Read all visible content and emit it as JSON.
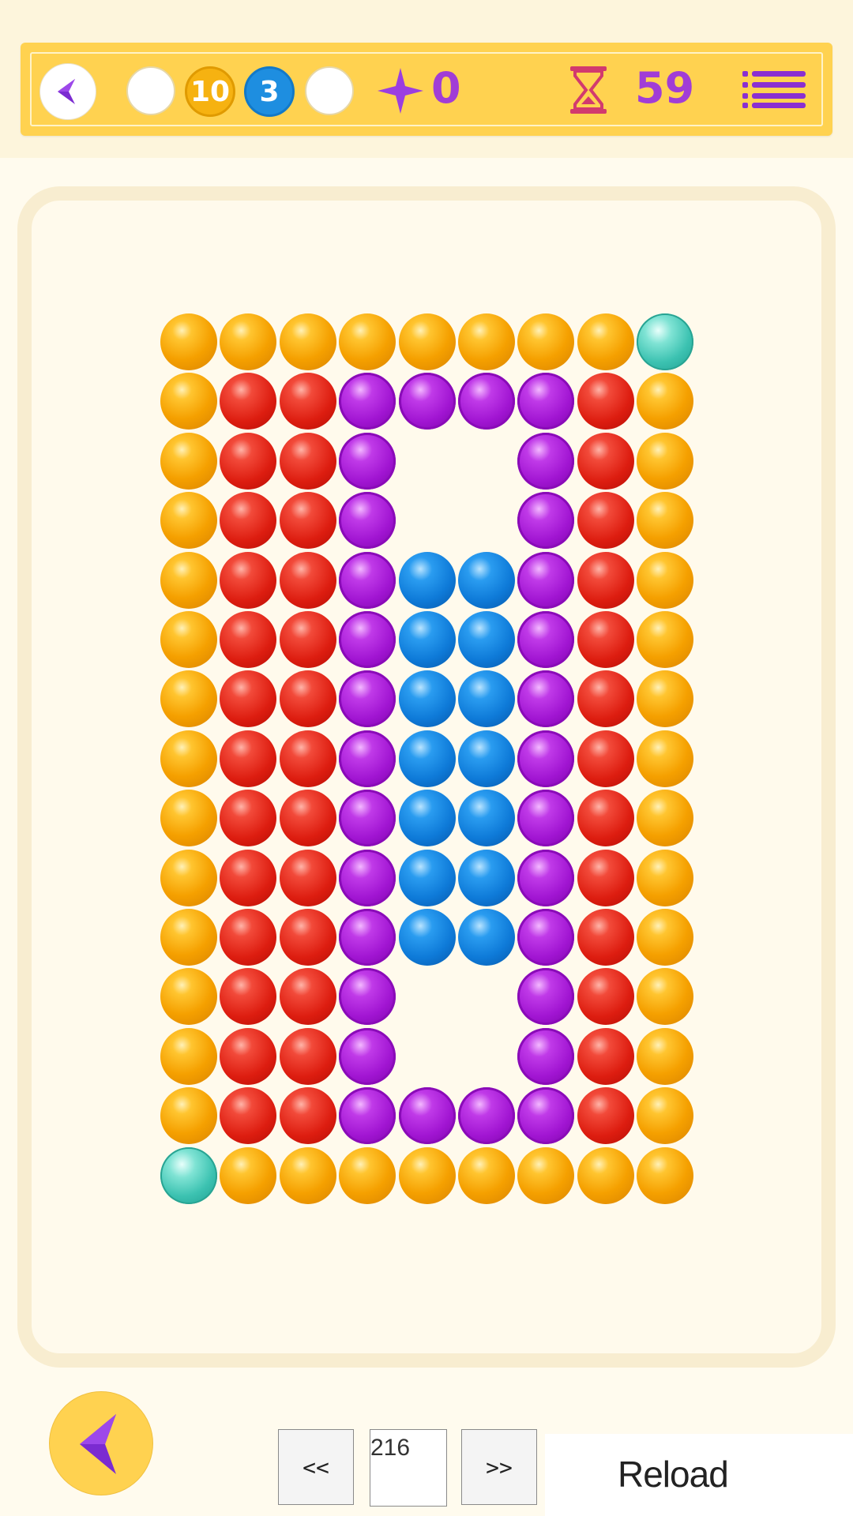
{
  "hud": {
    "coins": [
      {
        "type": "empty",
        "label": ""
      },
      {
        "type": "gold",
        "label": "10"
      },
      {
        "type": "blue",
        "label": "3"
      },
      {
        "type": "empty",
        "label": ""
      }
    ],
    "star_count": "0",
    "timer": "59",
    "icons": {
      "back": "chevron-left-icon",
      "star": "star-icon",
      "timer": "hourglass-icon",
      "menu": "menu-icon"
    }
  },
  "board": {
    "columns": 9,
    "rows": [
      [
        "O",
        "O",
        "O",
        "O",
        "O",
        "O",
        "O",
        "O",
        "T"
      ],
      [
        "O",
        "R",
        "R",
        "P",
        "P",
        "P",
        "P",
        "R",
        "O"
      ],
      [
        "O",
        "R",
        "R",
        "P",
        "_",
        "_",
        "P",
        "R",
        "O"
      ],
      [
        "O",
        "R",
        "R",
        "P",
        "_",
        "_",
        "P",
        "R",
        "O"
      ],
      [
        "O",
        "R",
        "R",
        "P",
        "B",
        "B",
        "P",
        "R",
        "O"
      ],
      [
        "O",
        "R",
        "R",
        "P",
        "B",
        "B",
        "P",
        "R",
        "O"
      ],
      [
        "O",
        "R",
        "R",
        "P",
        "B",
        "B",
        "P",
        "R",
        "O"
      ],
      [
        "O",
        "R",
        "R",
        "P",
        "B",
        "B",
        "P",
        "R",
        "O"
      ],
      [
        "O",
        "R",
        "R",
        "P",
        "B",
        "B",
        "P",
        "R",
        "O"
      ],
      [
        "O",
        "R",
        "R",
        "P",
        "B",
        "B",
        "P",
        "R",
        "O"
      ],
      [
        "O",
        "R",
        "R",
        "P",
        "B",
        "B",
        "P",
        "R",
        "O"
      ],
      [
        "O",
        "R",
        "R",
        "P",
        "_",
        "_",
        "P",
        "R",
        "O"
      ],
      [
        "O",
        "R",
        "R",
        "P",
        "_",
        "_",
        "P",
        "R",
        "O"
      ],
      [
        "O",
        "R",
        "R",
        "P",
        "P",
        "P",
        "P",
        "R",
        "O"
      ],
      [
        "T",
        "O",
        "O",
        "O",
        "O",
        "O",
        "O",
        "O",
        "O"
      ]
    ],
    "colors": {
      "O": "orange",
      "R": "red",
      "P": "purple",
      "B": "blue",
      "T": "teal"
    }
  },
  "footer": {
    "prev_label": "<<",
    "level_value": "216",
    "next_label": ">>",
    "reload_label": "Reload"
  },
  "colors": {
    "hud_bg": "#ffd250",
    "accent_purple": "#a13dd6",
    "board_border": "#f8edd0"
  }
}
